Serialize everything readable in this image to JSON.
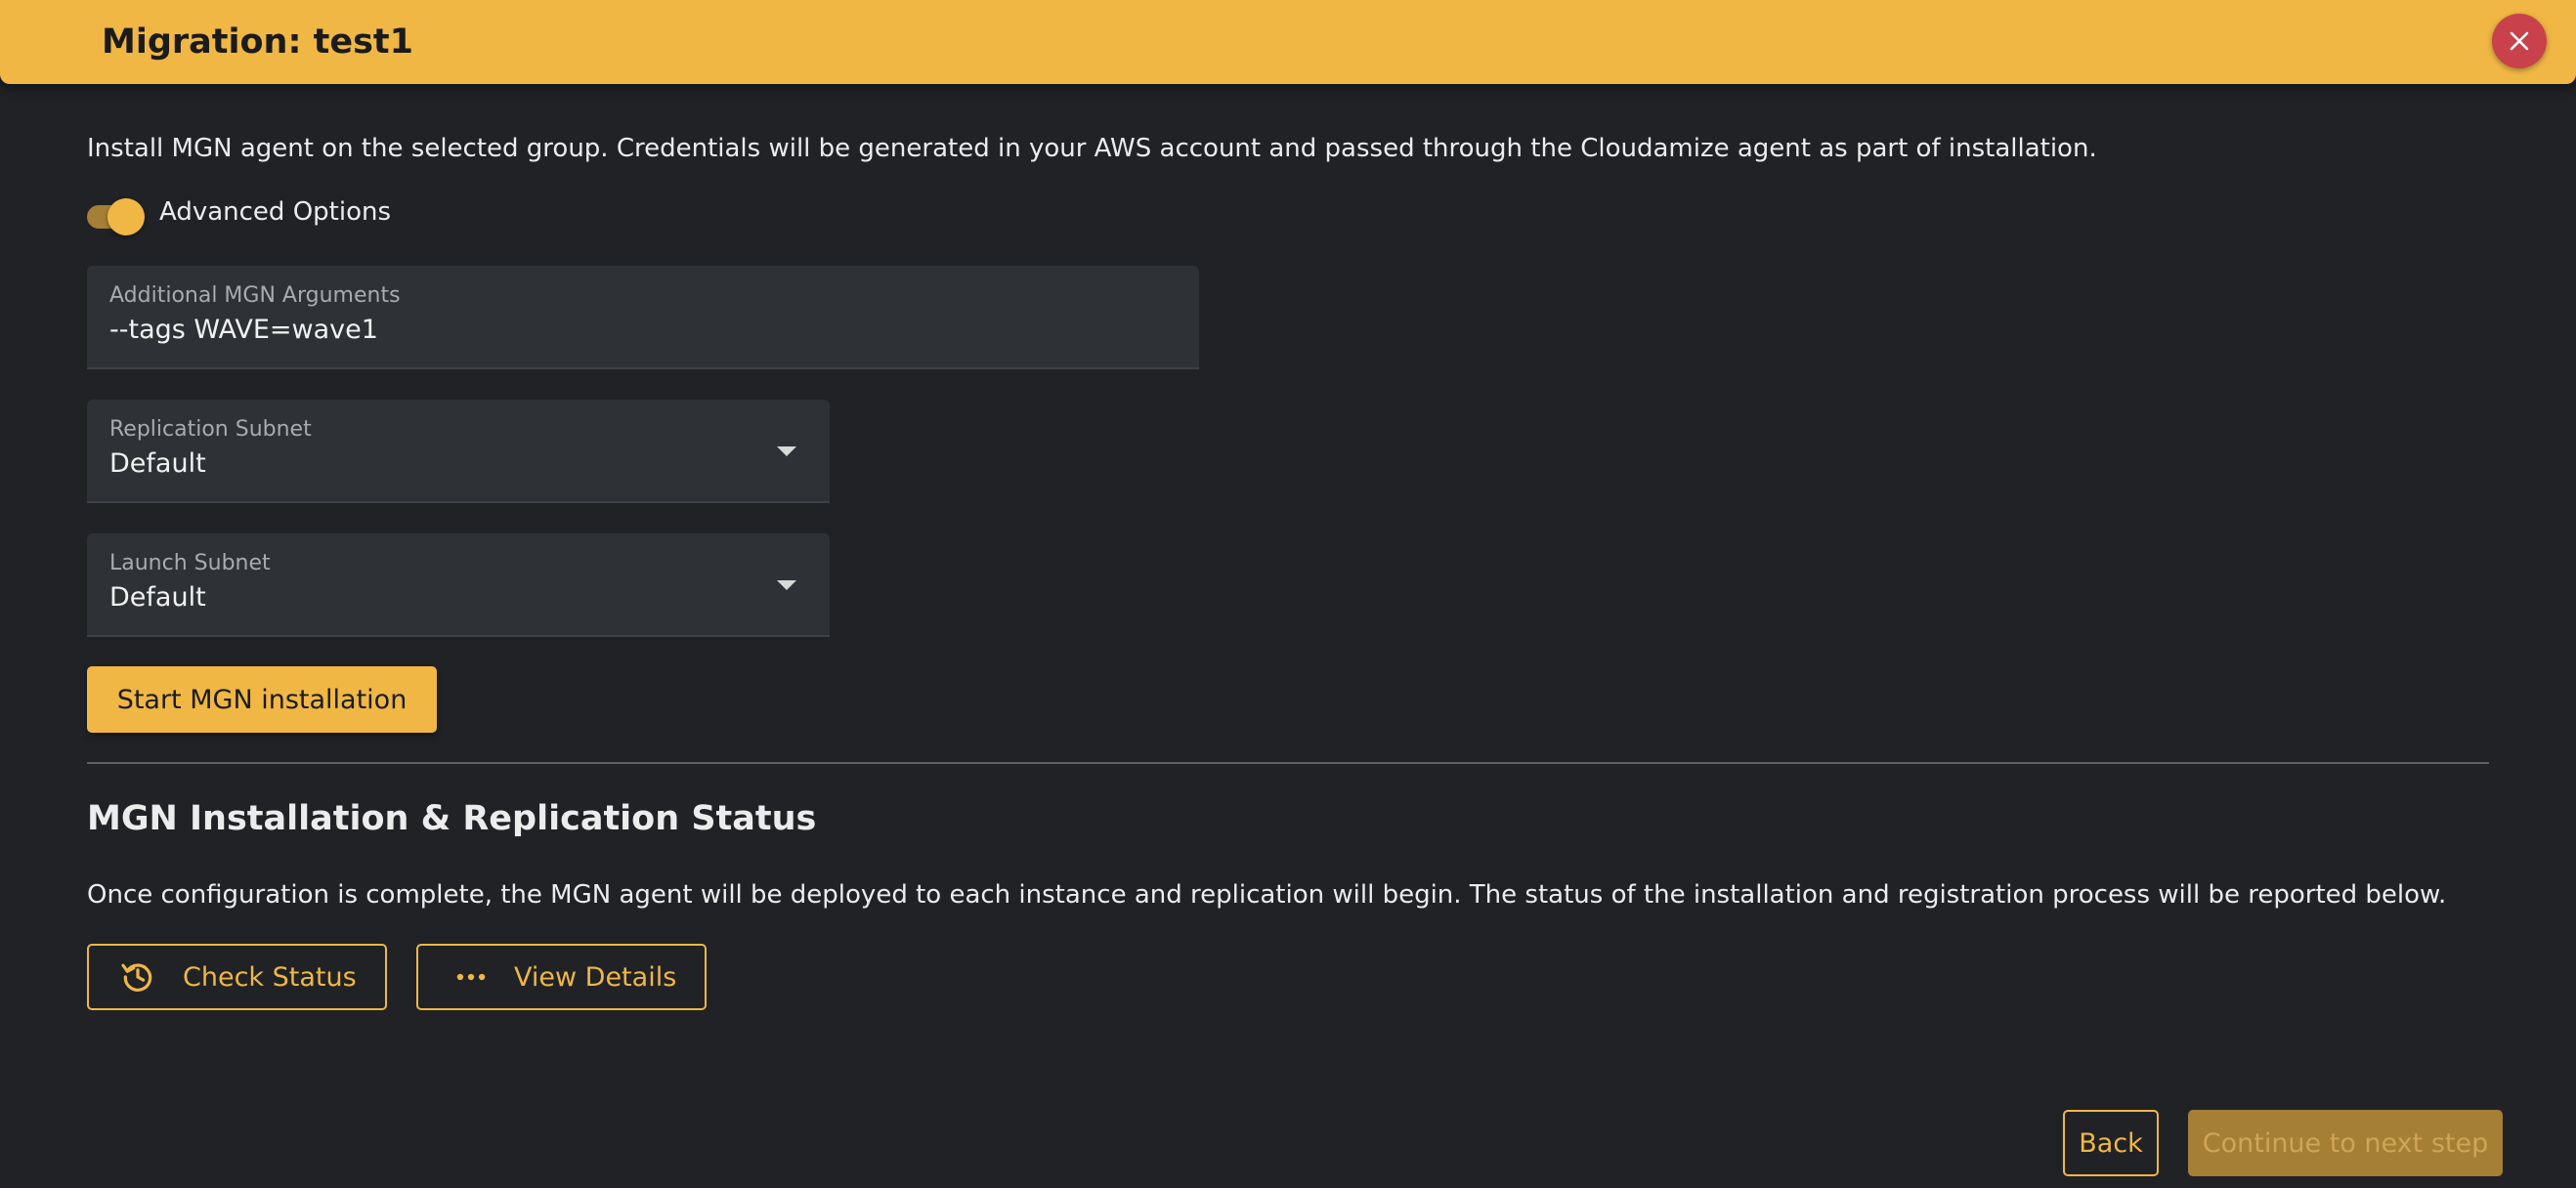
{
  "header": {
    "title": "Migration: test1",
    "close_icon": "close-icon",
    "accent_color": "#f0b745",
    "close_color": "#c8414b"
  },
  "install": {
    "description": "Install MGN agent on the selected group. Credentials will be generated in your AWS account and passed through the Cloudamize agent as part of installation.",
    "advanced_options": {
      "label": "Advanced Options",
      "enabled": true
    },
    "arguments": {
      "label": "Additional MGN Arguments",
      "value": "--tags WAVE=wave1"
    },
    "replication_subnet": {
      "label": "Replication Subnet",
      "value": "Default"
    },
    "launch_subnet": {
      "label": "Launch Subnet",
      "value": "Default"
    },
    "start_button": "Start MGN installation"
  },
  "status": {
    "title": "MGN Installation & Replication Status",
    "description": "Once configuration is complete, the MGN agent will be deployed to each instance and replication will begin. The status of the installation and registration process will be reported below.",
    "check_status_button": "Check Status",
    "check_status_icon": "refresh-clock-icon",
    "view_details_button": "View Details",
    "view_details_icon": "more-horizontal-icon"
  },
  "footer": {
    "back_button": "Back",
    "continue_button": "Continue to next step"
  }
}
